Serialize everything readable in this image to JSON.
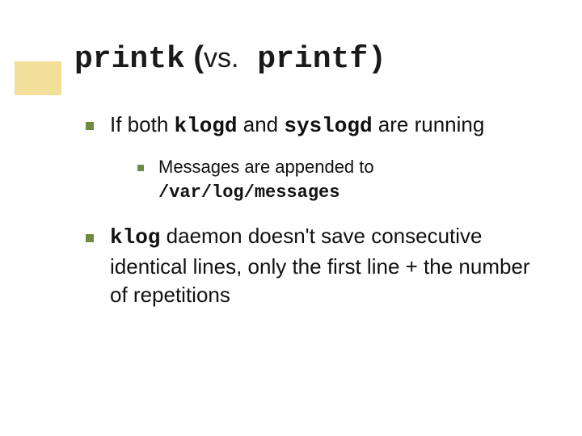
{
  "title": {
    "part1": "printk",
    "part2": " (",
    "vs": "vs.",
    "part3": " printf",
    "part4": ")"
  },
  "bullets": {
    "b1": {
      "t1": "If both ",
      "c1": "klogd",
      "t2": " and ",
      "c2": "syslogd",
      "t3": " are running",
      "sub": {
        "t1": "Messages are appended to ",
        "c1": "/var/log/messages"
      }
    },
    "b2": {
      "c1": "klog",
      "t1": " daemon doesn't save consecutive identical lines, only the first line + the number of repetitions"
    }
  }
}
